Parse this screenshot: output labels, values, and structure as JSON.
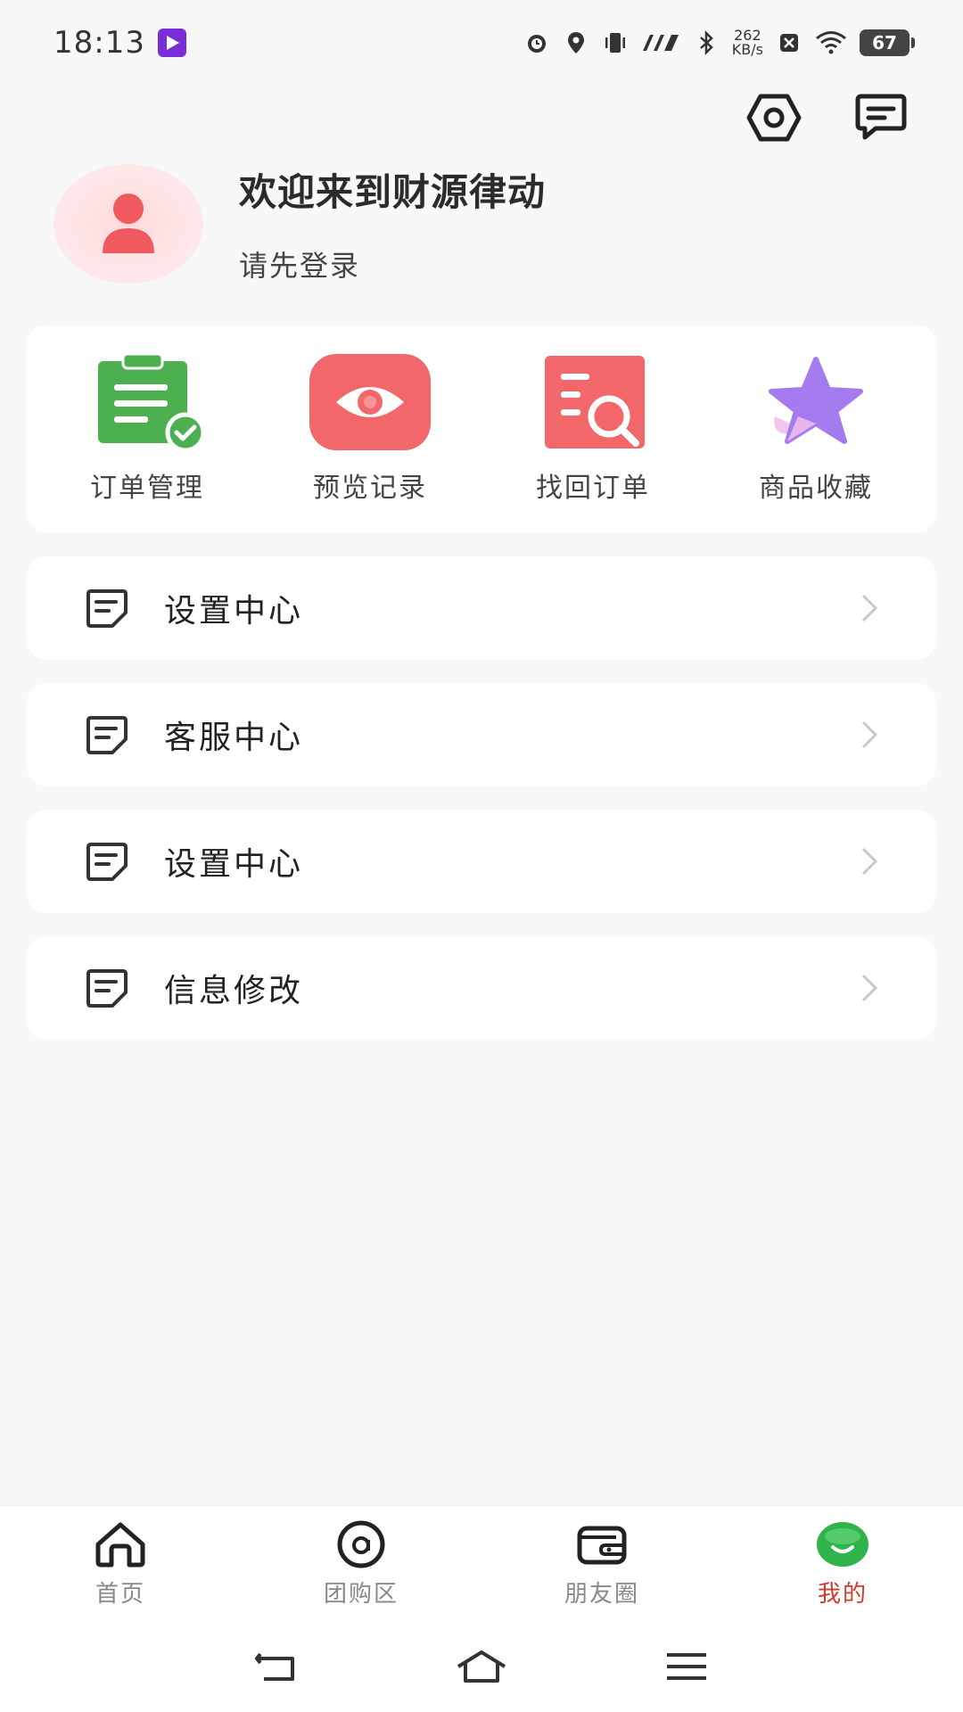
{
  "status_bar": {
    "time": "18:13",
    "net_speed_value": "262",
    "net_speed_unit": "KB/s",
    "battery": "67"
  },
  "top_actions": {
    "settings_icon": "hexagon-settings-icon",
    "message_icon": "message-icon"
  },
  "profile": {
    "welcome": "欢迎来到财源律动",
    "login_hint": "请先登录"
  },
  "shortcuts": [
    {
      "label": "订单管理",
      "icon": "clipboard-check-icon",
      "color": "#4caf50"
    },
    {
      "label": "预览记录",
      "icon": "eye-icon",
      "color": "#f2676a"
    },
    {
      "label": "找回订单",
      "icon": "document-search-icon",
      "color": "#f2676a"
    },
    {
      "label": "商品收藏",
      "icon": "star-icon",
      "color": "#a57cf0"
    }
  ],
  "menu": [
    {
      "label": "设置中心"
    },
    {
      "label": "客服中心"
    },
    {
      "label": "设置中心"
    },
    {
      "label": "信息修改"
    }
  ],
  "bottom_nav": [
    {
      "label": "首页",
      "icon": "home-icon"
    },
    {
      "label": "团购区",
      "icon": "group-buy-icon"
    },
    {
      "label": "朋友圈",
      "icon": "wallet-icon"
    },
    {
      "label": "我的",
      "icon": "smile-icon",
      "active": true
    }
  ],
  "colors": {
    "accent_red": "#d03a2c",
    "active_green": "#2fb34a",
    "avatar_red": "#f05a5e"
  }
}
